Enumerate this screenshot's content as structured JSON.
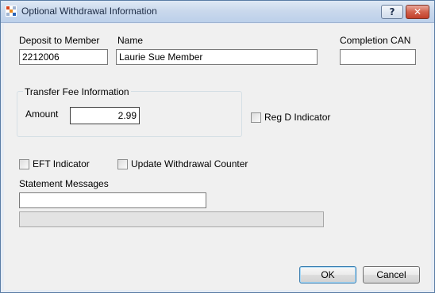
{
  "window": {
    "title": "Optional Withdrawal Information",
    "help_glyph": "?",
    "close_glyph": "✕"
  },
  "fields": {
    "deposit_label": "Deposit to Member",
    "deposit_value": "2212006",
    "name_label": "Name",
    "name_value": "Laurie Sue Member",
    "completion_label": "Completion CAN",
    "completion_value": ""
  },
  "transfer_fee": {
    "group_label": "Transfer Fee Information",
    "amount_label": "Amount",
    "amount_value": "2.99"
  },
  "checkboxes": {
    "reg_d": "Reg D Indicator",
    "eft": "EFT Indicator",
    "update_counter": "Update Withdrawal Counter"
  },
  "statement": {
    "label": "Statement Messages",
    "message1": "",
    "message2": ""
  },
  "buttons": {
    "ok": "OK",
    "cancel": "Cancel"
  }
}
